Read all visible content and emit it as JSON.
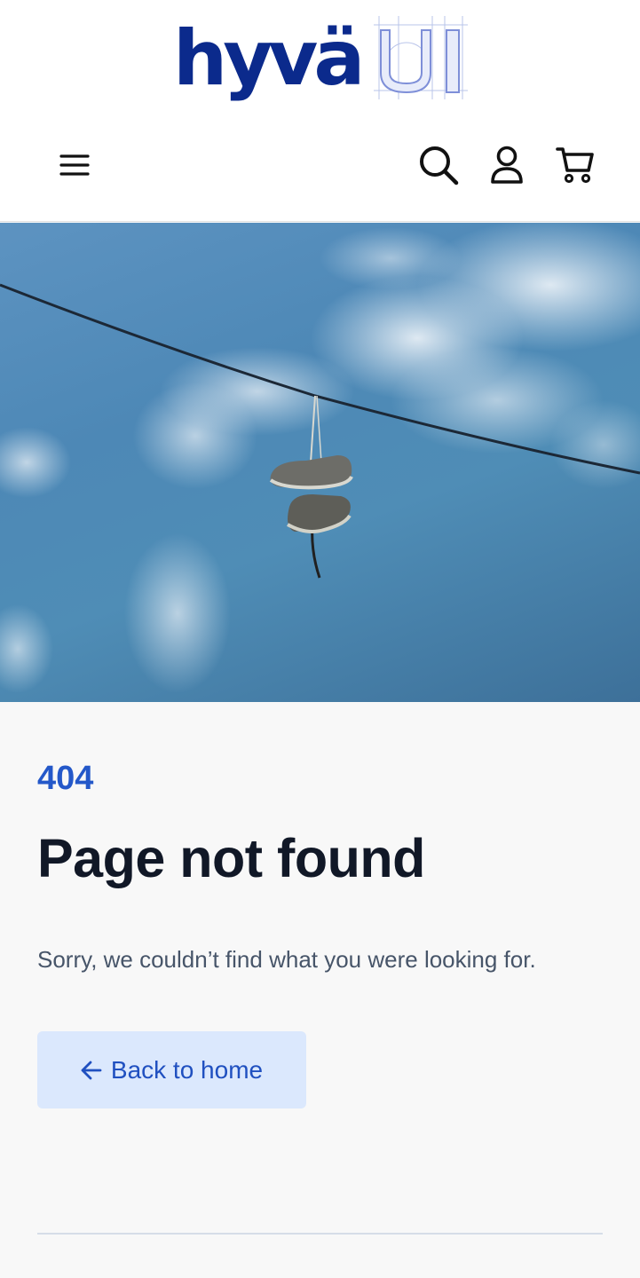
{
  "header": {
    "logo_text": "hyvä",
    "logo_suffix": "UI",
    "icons": {
      "menu": "hamburger-menu-icon",
      "search": "search-icon",
      "account": "user-icon",
      "cart": "shopping-cart-icon"
    }
  },
  "hero": {
    "image": "shoes-on-power-line-photo",
    "colors": {
      "sky": "#4d88b6",
      "cloud": "#dfe9f1"
    }
  },
  "main": {
    "error_code": "404",
    "title": "Page not found",
    "message": "Sorry, we couldn’t find what you were looking for.",
    "back_button": {
      "label": "Back to home",
      "icon": "arrow-left-icon"
    }
  },
  "colors": {
    "brand": "#0b2a8c",
    "accent": "#2458c9",
    "button_bg": "#dbe8fd",
    "heading": "#111827",
    "body_text": "#475569"
  }
}
